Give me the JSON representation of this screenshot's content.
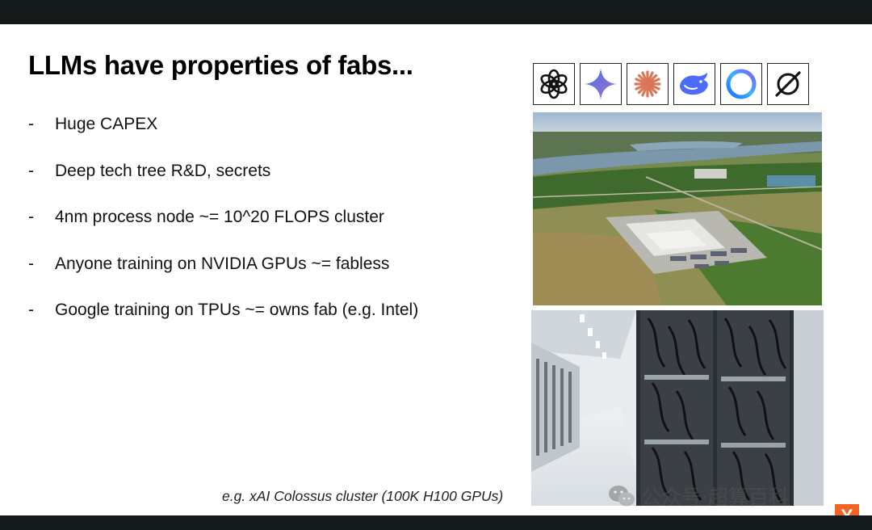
{
  "slide": {
    "title": "LLMs have properties of fabs...",
    "bullets": [
      {
        "marker": "-",
        "text": "Huge CAPEX"
      },
      {
        "marker": "-",
        "text": "Deep tech tree R&D, secrets"
      },
      {
        "marker": "-",
        "text": "4nm process node ~= 10^20 FLOPS cluster"
      },
      {
        "marker": "-",
        "text": "Anyone training on NVIDIA GPUs ~= fabless"
      },
      {
        "marker": "-",
        "text": "Google training on TPUs ~= owns fab (e.g. Intel)"
      }
    ],
    "caption": "e.g. xAI Colossus cluster (100K H100 GPUs)",
    "logos": [
      "openai-icon",
      "gemini-icon",
      "claude-icon",
      "deepseek-icon",
      "meta-icon",
      "grok-icon"
    ],
    "images": [
      "aerial-datacenter-photo",
      "server-racks-photo"
    ]
  },
  "overlay": {
    "watermark_text": "公众号·超算百科",
    "badge_letter": "Y"
  },
  "colors": {
    "frame": "#141a1a",
    "badge": "#f26522",
    "gemini": "#4f6fe8",
    "claude": "#d97757",
    "deepseek": "#4d6bfe"
  }
}
